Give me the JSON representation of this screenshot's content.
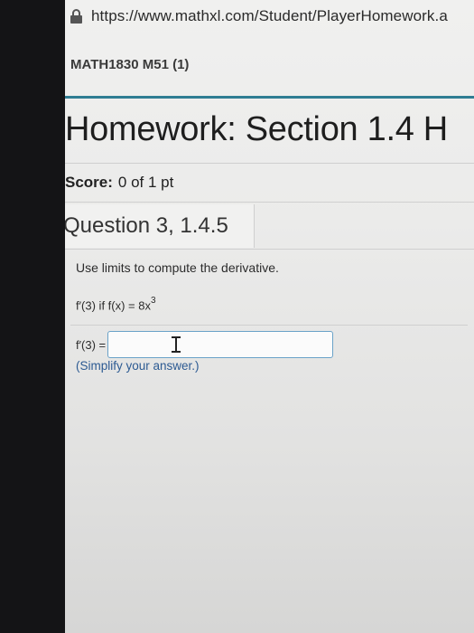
{
  "browser": {
    "url": "https://www.mathxl.com/Student/PlayerHomework.a"
  },
  "course": {
    "title": "MATH1830 M51 (1)"
  },
  "homework": {
    "title": "Homework: Section 1.4 H"
  },
  "score": {
    "label": "Score:",
    "value": "0 of 1 pt"
  },
  "question": {
    "title": "Question 3, 1.4.5",
    "instruction": "Use limits to compute the derivative.",
    "function_prefix": "f′(3) if f(x) = 8x",
    "function_exponent": "3",
    "answer_label": "f′(3) =",
    "answer_value": "",
    "hint": "(Simplify your answer.)"
  },
  "colors": {
    "accent": "#2f7d93",
    "input_border": "#6aa2c8",
    "hint_text": "#2c5a92"
  },
  "icons": {
    "lock": "lock-icon",
    "cursor": "ibeam-cursor-icon"
  }
}
